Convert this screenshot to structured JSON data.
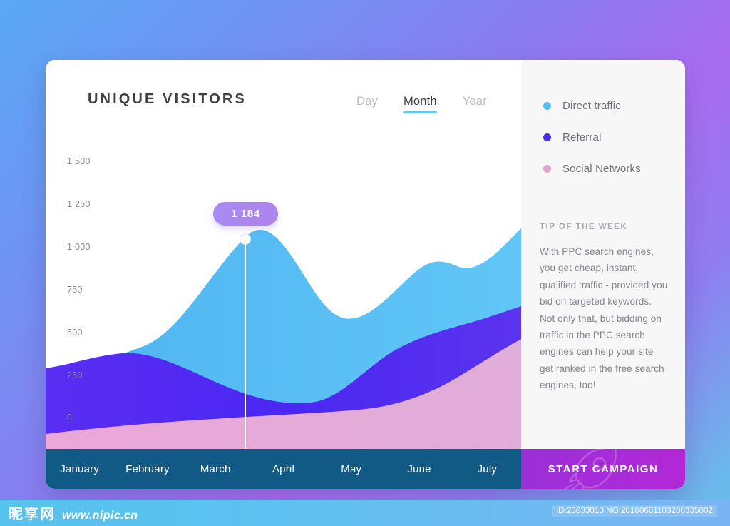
{
  "header": {
    "title": "UNIQUE VISITORS",
    "tabs": [
      {
        "label": "Day",
        "active": false
      },
      {
        "label": "Month",
        "active": true
      },
      {
        "label": "Year",
        "active": false
      }
    ]
  },
  "tooltip": {
    "value": "1 184"
  },
  "sidebar": {
    "legend": [
      {
        "label": "Direct traffic",
        "color": "#54bdf2"
      },
      {
        "label": "Referral",
        "color": "#4c2ef0"
      },
      {
        "label": "Social Networks",
        "color": "#e0a6d0"
      }
    ],
    "tip": {
      "title": "TIP OF THE WEEK",
      "body": "With PPC search engines, you get cheap, instant, qualified traffic - provided you bid on targeted keywords. Not only that, but bidding on traffic in the PPC search engines can help your site get ranked in the free search engines, too!"
    },
    "cta": {
      "label": "START CAMPAIGN",
      "icon": "rocket-icon"
    }
  },
  "watermark": {
    "site_cn": "昵享网",
    "site_url": "www.nipic.cn",
    "id_text": "ID:23033013 NO:20160601103200335002"
  },
  "chart_data": {
    "type": "area",
    "title": "UNIQUE VISITORS",
    "xlabel": "",
    "ylabel": "",
    "stacked": true,
    "grid": false,
    "legend_position": "right",
    "ylim": [
      0,
      1500
    ],
    "yticks": [
      "0",
      "250",
      "500",
      "750",
      "1 000",
      "1 250",
      "1 500"
    ],
    "ytick_values": [
      0,
      250,
      500,
      750,
      1000,
      1250,
      1500
    ],
    "categories": [
      "January",
      "February",
      "March",
      "April",
      "May",
      "June",
      "July"
    ],
    "highlight": {
      "category": "March",
      "total": 1184
    },
    "series": [
      {
        "name": "Social Networks",
        "color": "#e0a6d0",
        "values": [
          250,
          300,
          330,
          350,
          380,
          430,
          560
        ]
      },
      {
        "name": "Referral",
        "color": "#4c2ef0",
        "values": [
          310,
          290,
          250,
          310,
          480,
          540,
          560
        ]
      },
      {
        "name": "Direct traffic",
        "color": "#54bdf2",
        "values": [
          0,
          140,
          604,
          380,
          420,
          330,
          380
        ]
      }
    ]
  }
}
